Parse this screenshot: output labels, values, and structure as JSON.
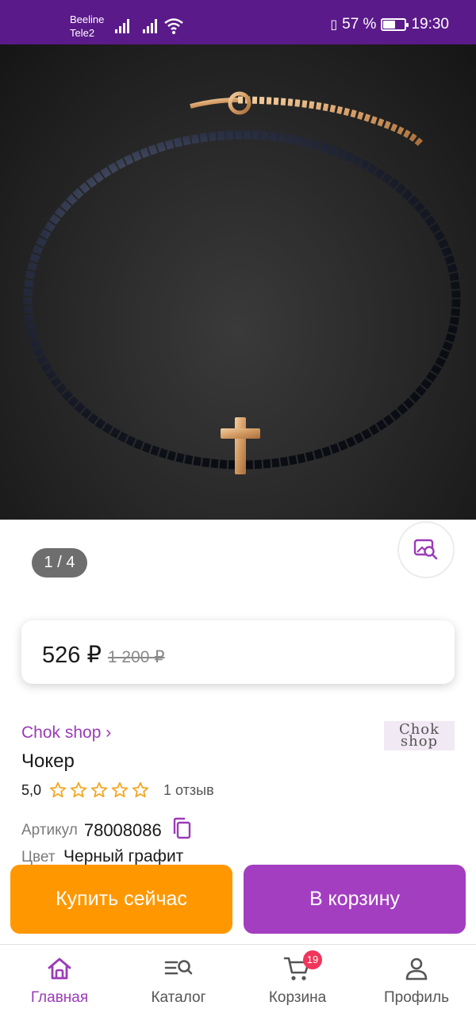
{
  "status_bar": {
    "carrier1": "Beeline",
    "carrier2": "Tele2",
    "battery_text": "57 %",
    "battery_level": 0.57,
    "time": "19:30",
    "icons": [
      "signal-icon",
      "signal-icon",
      "wifi-icon",
      "vibrate-icon",
      "battery-icon"
    ]
  },
  "gallery": {
    "counter": "1 / 4",
    "visual_search_icon": "image-search-icon"
  },
  "price": {
    "current": "526 ₽",
    "old": "1 200 ₽"
  },
  "seller": {
    "link_text": "Chok shop ›",
    "logo_line1": "Chok",
    "logo_line2": "shop"
  },
  "product": {
    "title": "Чокер",
    "rating_value": "5,0",
    "rating_stars": 5,
    "reviews": "1 отзыв",
    "sku_label": "Артикул",
    "sku_value": "78008086",
    "color_label": "Цвет",
    "color_value": "Черный графит"
  },
  "actions": {
    "buy_now": "Купить сейчас",
    "add_to_cart": "В корзину"
  },
  "nav": {
    "home": "Главная",
    "catalog": "Каталог",
    "cart": "Корзина",
    "cart_badge": "19",
    "profile": "Профиль",
    "active": "home"
  },
  "colors": {
    "status_bar": "#5b1a8a",
    "accent": "#9b3bb8",
    "buy_button": "#ff9800",
    "cart_button": "#a33ec1",
    "badge": "#f2355b"
  }
}
